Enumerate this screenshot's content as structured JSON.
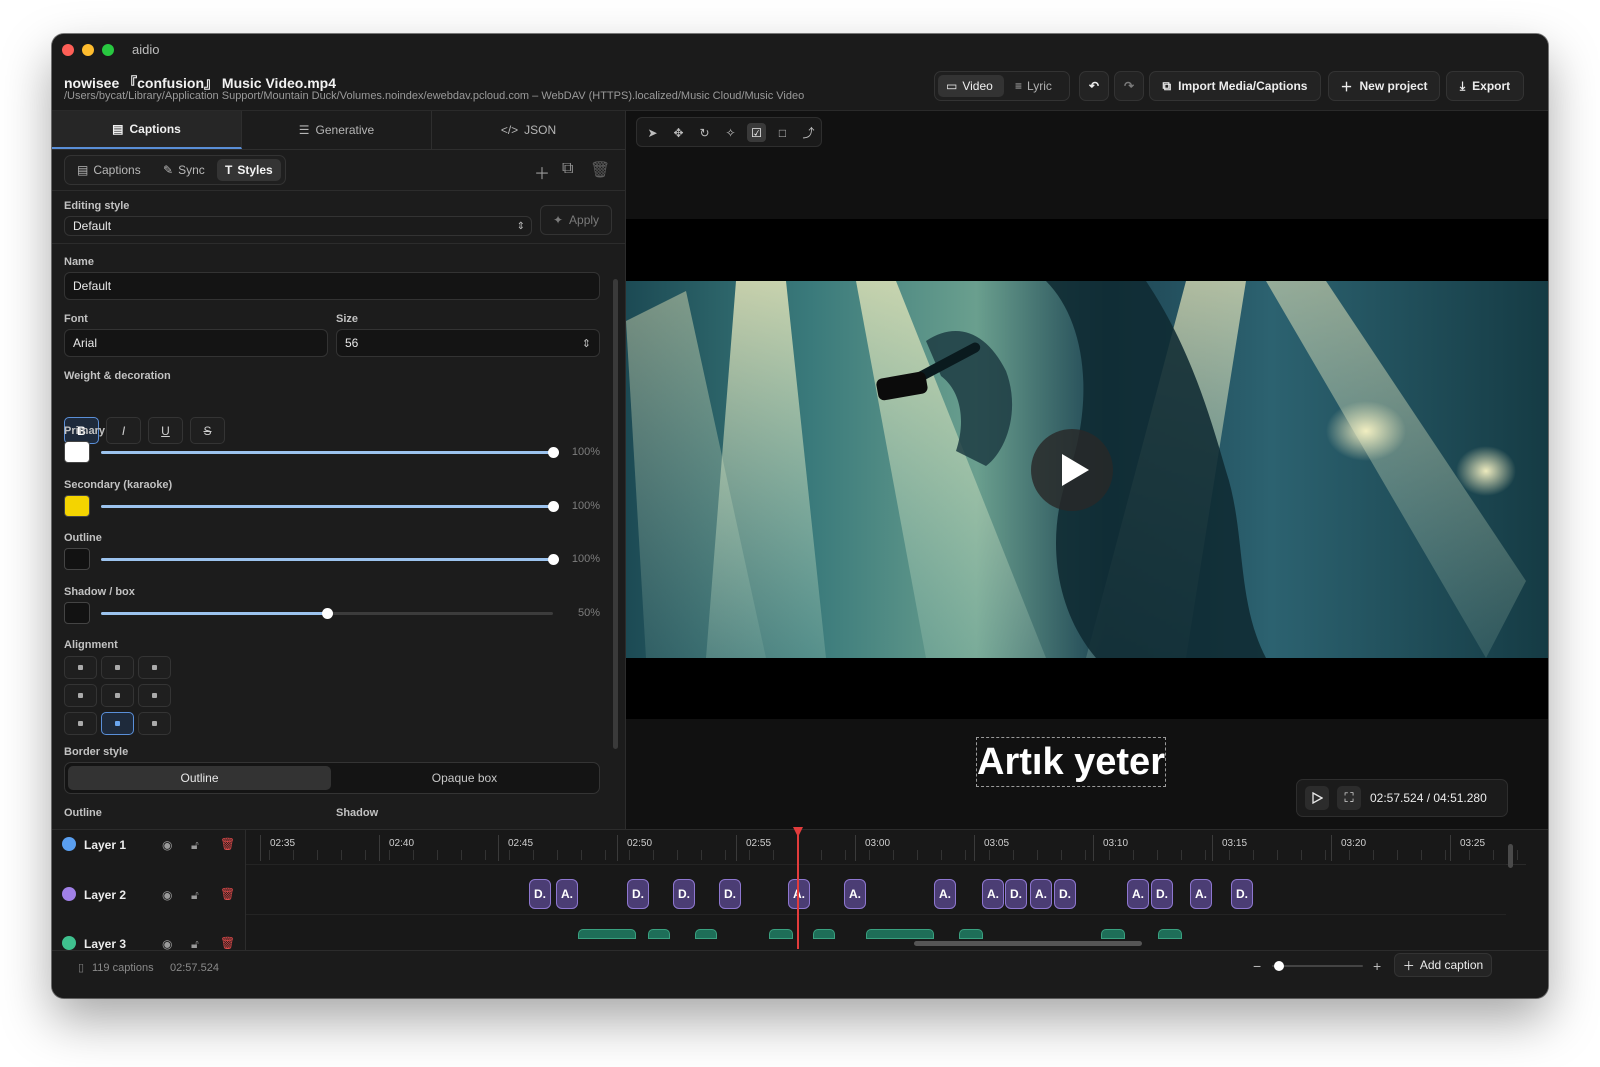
{
  "app": {
    "title": "aidio"
  },
  "header": {
    "file_name": "nowisee 『confusion』 Music Video.mp4",
    "file_path": "/Users/bycat/Library/Application Support/Mountain Duck/Volumes.noindex/ewebdav.pcloud.com – WebDAV (HTTPS).localized/Music Cloud/Music Video",
    "mode_video": "Video",
    "mode_lyric": "Lyric",
    "import_label": "Import Media/Captions",
    "new_project_label": "New project",
    "export_label": "Export"
  },
  "left_tabs": [
    "Captions",
    "Generative",
    "JSON"
  ],
  "sub_tabs": [
    "Captions",
    "Sync",
    "Styles"
  ],
  "style_editor": {
    "editing_style_label": "Editing style",
    "editing_style_value": "Default",
    "apply_label": "Apply",
    "name_label": "Name",
    "name_value": "Default",
    "font_label": "Font",
    "font_value": "Arial",
    "size_label": "Size",
    "size_value": "56",
    "weight_label": "Weight & decoration",
    "weight_buttons": [
      "B",
      "I",
      "U",
      "S"
    ],
    "colors": [
      {
        "label": "Primary",
        "swatch": "#ffffff",
        "percent_text": "100%",
        "value": 1.0
      },
      {
        "label": "Secondary (karaoke)",
        "swatch": "#f4d400",
        "percent_text": "100%",
        "value": 1.0
      },
      {
        "label": "Outline",
        "swatch": "#121212",
        "percent_text": "100%",
        "value": 1.0
      },
      {
        "label": "Shadow / box",
        "swatch": "#121212",
        "percent_text": "50%",
        "value": 0.5
      }
    ],
    "alignment_label": "Alignment",
    "alignment_selected": "bottom-center",
    "border_style_label": "Border style",
    "border_options": [
      "Outline",
      "Opaque box"
    ],
    "outline_label": "Outline",
    "shadow_label": "Shadow"
  },
  "viewer": {
    "caption_text": "Artık yeter",
    "time_display": "02:57.524 / 04:51.280"
  },
  "timeline": {
    "layers": [
      {
        "name": "Layer 1",
        "color": "#5a9ff0"
      },
      {
        "name": "Layer 2",
        "color": "#a080e6"
      },
      {
        "name": "Layer 3",
        "color": "#3fc08e"
      }
    ],
    "ticks": [
      "02:35",
      "02:40",
      "02:45",
      "02:50",
      "02:55",
      "03:00",
      "03:05",
      "03:10",
      "03:15",
      "03:20",
      "03:25"
    ],
    "clips": [
      "D.",
      "A.",
      "D.",
      "D.",
      "D.",
      "A.",
      "A.",
      "A.",
      "A.",
      "D.",
      "A.",
      "D.",
      "A.",
      "D.",
      "A.",
      "D."
    ]
  },
  "status": {
    "caption_count": "119 captions",
    "current_time": "02:57.524",
    "add_caption_label": "Add caption"
  },
  "colors": {
    "accent": "#5a8fd8",
    "playhead": "#e23c3c"
  }
}
